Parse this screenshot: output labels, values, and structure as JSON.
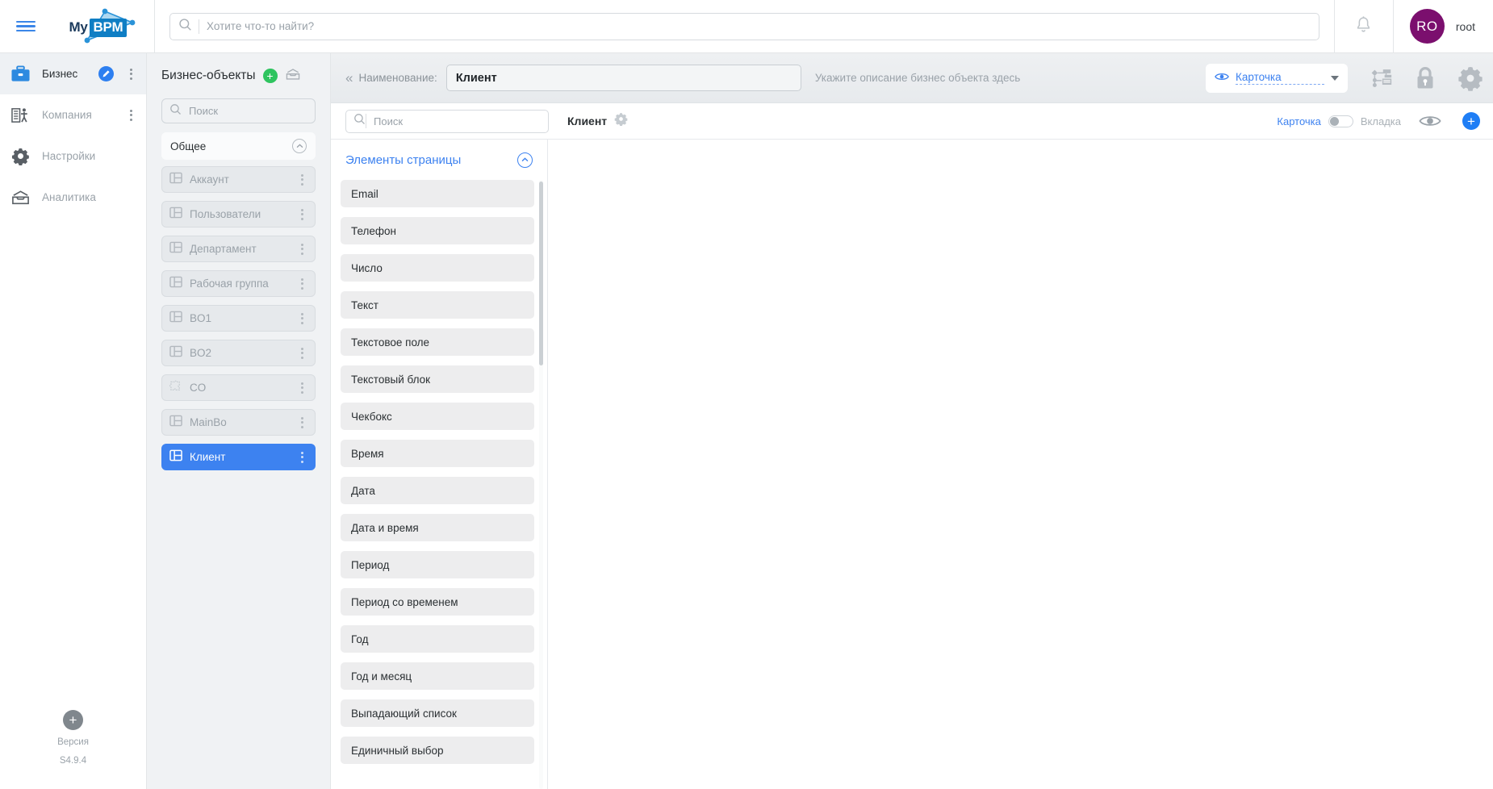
{
  "topbar": {
    "menu_icon": "hamburger-menu-icon",
    "logo": {
      "prefix": "My",
      "badge": "BPM"
    },
    "search": {
      "value": "",
      "placeholder": "Хотите что-то найти?",
      "icon": "search-icon"
    },
    "notifications_icon": "bell-icon",
    "user": {
      "initials": "RO",
      "name": "root"
    }
  },
  "sidebar": {
    "items": [
      {
        "label": "Бизнес",
        "icon": "briefcase-icon",
        "active": true
      },
      {
        "label": "Компания",
        "icon": "building-person-icon",
        "active": false
      },
      {
        "label": "Настройки",
        "icon": "gear-icon",
        "active": false
      },
      {
        "label": "Аналитика",
        "icon": "inbox-tray-icon",
        "active": false
      }
    ],
    "footer": {
      "add_icon": "plus-circle-icon",
      "version_label": "Версия",
      "version_value": "S4.9.4"
    }
  },
  "business_objects": {
    "title": "Бизнес-объекты",
    "add_icon": "plus-circle-green-icon",
    "archive_icon": "archive-tray-icon",
    "search": {
      "value": "",
      "placeholder": "Поиск",
      "icon": "search-icon"
    },
    "group": {
      "label": "Общее",
      "collapse_icon": "chevron-up-circle-icon"
    },
    "items": [
      {
        "label": "Аккаунт",
        "icon": "table-layout-icon",
        "selected": false
      },
      {
        "label": "Пользователи",
        "icon": "table-layout-icon",
        "selected": false
      },
      {
        "label": "Департамент",
        "icon": "table-layout-icon",
        "selected": false
      },
      {
        "label": "Рабочая группа",
        "icon": "table-layout-icon",
        "selected": false
      },
      {
        "label": "BO1",
        "icon": "table-layout-icon",
        "selected": false
      },
      {
        "label": "BO2",
        "icon": "table-layout-icon",
        "selected": false
      },
      {
        "label": "CO",
        "icon": "puzzle-piece-icon",
        "selected": false
      },
      {
        "label": "MainBo",
        "icon": "table-layout-icon",
        "selected": false
      },
      {
        "label": "Клиент",
        "icon": "table-layout-icon",
        "selected": true
      }
    ]
  },
  "toolbar": {
    "collapse_icon": "double-chevron-left-icon",
    "name_label": "Наименование:",
    "name_value": "Клиент",
    "description_placeholder": "Укажите описание бизнес объекта здесь",
    "view_select": {
      "icon": "eye-icon",
      "value": "Карточка",
      "caret_icon": "chevron-down-icon"
    },
    "icons": [
      {
        "name": "workflow-diagram-icon"
      },
      {
        "name": "lock-icon"
      },
      {
        "name": "gear-icon"
      }
    ]
  },
  "subbar": {
    "search": {
      "value": "",
      "placeholder": "Поиск",
      "icon": "search-icon"
    },
    "tab": {
      "label": "Клиент",
      "settings_icon": "gear-icon"
    },
    "toggle": {
      "left_label": "Карточка",
      "right_label": "Вкладка",
      "checked": false
    },
    "preview_icon": "eye-icon",
    "add_icon": "plus-circle-blue-icon"
  },
  "elements_panel": {
    "title": "Элементы страницы",
    "collapse_icon": "chevron-up-circle-icon",
    "items": [
      "Email",
      "Телефон",
      "Число",
      "Текст",
      "Текстовое поле",
      "Текстовый блок",
      "Чекбокс",
      "Время",
      "Дата",
      "Дата и время",
      "Период",
      "Период со временем",
      "Год",
      "Год и месяц",
      "Выпадающий список",
      "Единичный выбор"
    ]
  },
  "colors": {
    "accent_blue": "#3d82f0",
    "accent_green": "#2ec45f",
    "avatar_purple": "#7b0f6e",
    "panel_gray": "#f0f2f4",
    "item_gray": "#ededee"
  }
}
